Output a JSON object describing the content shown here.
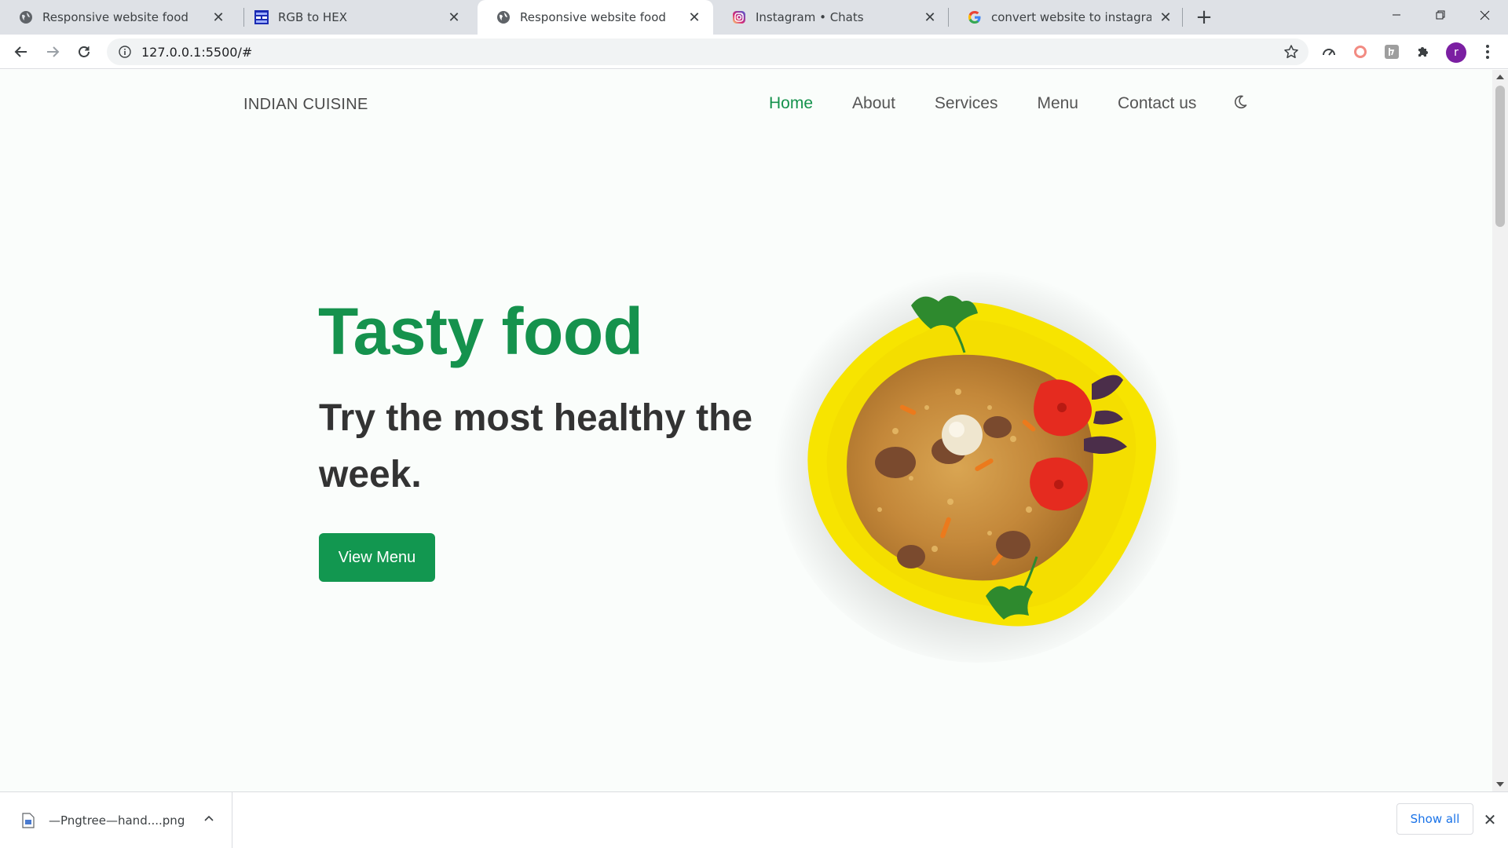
{
  "browser": {
    "tabs": [
      {
        "title": "Responsive website food",
        "icon": "globe-icon",
        "active": false
      },
      {
        "title": "RGB to HEX",
        "icon": "rgbhex-site-icon",
        "active": false
      },
      {
        "title": "Responsive website food",
        "icon": "globe-icon",
        "active": true
      },
      {
        "title": "Instagram • Chats",
        "icon": "instagram-icon",
        "active": false
      },
      {
        "title": "convert website to instagram pos",
        "icon": "google-icon",
        "active": false
      }
    ],
    "url": "127.0.0.1:5500/#",
    "avatar_letter": "r"
  },
  "site": {
    "logo": "INDIAN CUISINE",
    "nav": [
      {
        "label": "Home",
        "active": true
      },
      {
        "label": "About",
        "active": false
      },
      {
        "label": "Services",
        "active": false
      },
      {
        "label": "Menu",
        "active": false
      },
      {
        "label": "Contact us",
        "active": false
      }
    ],
    "hero": {
      "title": "Tasty food",
      "subtitle": "Try the most healthy the week.",
      "button": "View Menu"
    }
  },
  "downloads": {
    "file": "—Pngtree—hand....png",
    "show_all": "Show all"
  },
  "colors": {
    "brand_green": "#15924d",
    "button_green": "#129750",
    "plate_yellow": "#f7e400",
    "avatar_purple": "#7b1fa2"
  }
}
